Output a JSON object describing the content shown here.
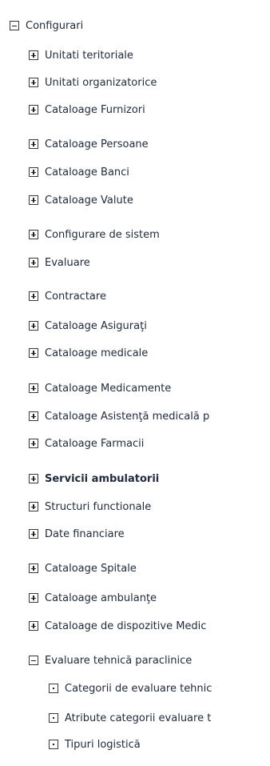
{
  "tree": {
    "root": {
      "label": "Configurari",
      "state": "expanded"
    },
    "children": [
      {
        "label": "Unitati teritoriale",
        "state": "collapsed"
      },
      {
        "label": "Unitati organizatorice",
        "state": "collapsed"
      },
      {
        "label": "Cataloage Furnizori",
        "state": "collapsed"
      },
      {
        "label": "Cataloage Persoane",
        "state": "collapsed"
      },
      {
        "label": "Cataloage Banci",
        "state": "collapsed"
      },
      {
        "label": "Cataloage Valute",
        "state": "collapsed"
      },
      {
        "label": "Configurare de sistem",
        "state": "collapsed"
      },
      {
        "label": "Evaluare",
        "state": "collapsed"
      },
      {
        "label": "Contractare",
        "state": "collapsed"
      },
      {
        "label": "Cataloage Asiguraţi",
        "state": "collapsed"
      },
      {
        "label": "Cataloage medicale",
        "state": "collapsed"
      },
      {
        "label": "Cataloage Medicamente",
        "state": "collapsed"
      },
      {
        "label": "Cataloage Asistenţă medicală p",
        "state": "collapsed"
      },
      {
        "label": "Cataloage Farmacii",
        "state": "collapsed"
      },
      {
        "label": "Servicii ambulatorii",
        "state": "collapsed",
        "bold": true
      },
      {
        "label": "Structuri functionale",
        "state": "collapsed"
      },
      {
        "label": "Date financiare",
        "state": "collapsed"
      },
      {
        "label": "Cataloage Spitale",
        "state": "collapsed"
      },
      {
        "label": "Cataloage ambulanţe",
        "state": "collapsed"
      },
      {
        "label": "Cataloage de dispozitive Medic",
        "state": "collapsed"
      },
      {
        "label": "Evaluare tehnică paraclinice",
        "state": "expanded",
        "children": [
          {
            "label": "Categorii de evaluare tehnic",
            "state": "leaf"
          },
          {
            "label": "Atribute categorii evaluare t",
            "state": "leaf"
          },
          {
            "label": "Tipuri logistică",
            "state": "leaf"
          }
        ]
      }
    ]
  }
}
